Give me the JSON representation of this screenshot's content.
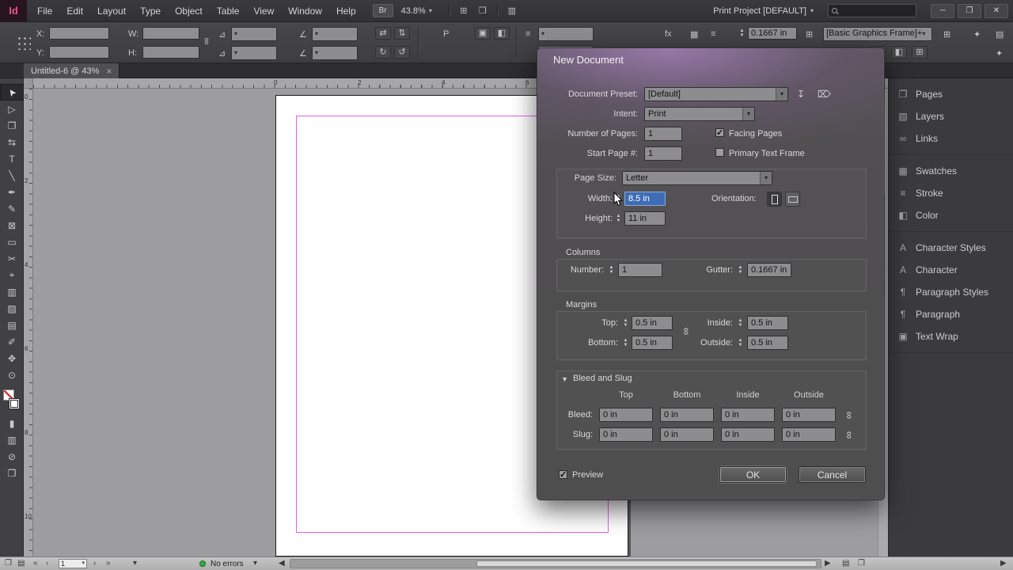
{
  "titlebar": {
    "logo": "Id",
    "menus": [
      "File",
      "Edit",
      "Layout",
      "Type",
      "Object",
      "Table",
      "View",
      "Window",
      "Help"
    ],
    "bridge_label": "Br",
    "zoom_value": "43.8%",
    "workspace_name": "Print Project [DEFAULT]"
  },
  "icons": {
    "chevron_down": "▾",
    "grid": "⊞",
    "screen_mode": "❒",
    "arrange_docs": "▥",
    "minimize": "─",
    "restore": "❐",
    "close": "✕",
    "chain": "∞",
    "flip_h": "⇄",
    "flip_v": "⇅",
    "rotate_cw": "↻",
    "rotate_ccw": "↺",
    "angle": "∠",
    "scale": "⊿",
    "stroke_lines": "≡",
    "swatch_grid": "▦",
    "container": "▣",
    "content": "◧",
    "effects_fx": "fx",
    "quick_apply": "✦",
    "list": "▤",
    "save_preset": "↧",
    "delete_preset": "⌦",
    "disclosure": "▼",
    "page_first": "«",
    "page_prev": "‹",
    "page_next": "›",
    "page_last": "»",
    "scroll_left": "◀",
    "scroll_right": "▶",
    "pages_proxy": "P"
  },
  "control_panel": {
    "x_label": "X:",
    "y_label": "Y:",
    "w_label": "W:",
    "h_label": "H:",
    "stroke_weight_value": "0.1667 in",
    "object_style_value": "[Basic Graphics Frame]+"
  },
  "tab": {
    "title": "Untitled-6 @ 43%",
    "close_glyph": "×"
  },
  "rulers": {
    "h_numbers": [
      "0",
      "2",
      "4",
      "6"
    ],
    "v_numbers": [
      "0",
      "2",
      "4",
      "6",
      "8",
      "10"
    ]
  },
  "toolbar": {
    "tools": [
      {
        "name": "selection",
        "glyph": "➤"
      },
      {
        "name": "direct-selection",
        "glyph": "▷"
      },
      {
        "name": "page",
        "glyph": "❐"
      },
      {
        "name": "gap",
        "glyph": "⇆"
      },
      {
        "name": "type",
        "glyph": "T"
      },
      {
        "name": "line",
        "glyph": "╲"
      },
      {
        "name": "pen",
        "glyph": "✒"
      },
      {
        "name": "pencil",
        "glyph": "✎"
      },
      {
        "name": "rectangle-frame",
        "glyph": "⊠"
      },
      {
        "name": "rectangle",
        "glyph": "▭"
      },
      {
        "name": "scissors",
        "glyph": "✂"
      },
      {
        "name": "free-transform",
        "glyph": "⌖"
      },
      {
        "name": "gradient",
        "glyph": "▥"
      },
      {
        "name": "gradient-feather",
        "glyph": "▨"
      },
      {
        "name": "note",
        "glyph": "▤"
      },
      {
        "name": "eyedropper",
        "glyph": "✐"
      },
      {
        "name": "hand",
        "glyph": "✥"
      },
      {
        "name": "zoom",
        "glyph": "⊙"
      }
    ],
    "bottom_tools": [
      {
        "name": "apply-color",
        "glyph": "▮"
      },
      {
        "name": "apply-gradient",
        "glyph": "▥"
      },
      {
        "name": "apply-none",
        "glyph": "⊘"
      },
      {
        "name": "screen-mode",
        "glyph": "❒"
      }
    ]
  },
  "right_panel": {
    "group1": [
      {
        "name": "pages",
        "glyph": "❐",
        "label": "Pages"
      },
      {
        "name": "layers",
        "glyph": "▧",
        "label": "Layers"
      },
      {
        "name": "links",
        "glyph": "∞",
        "label": "Links"
      }
    ],
    "group2": [
      {
        "name": "swatches",
        "glyph": "▦",
        "label": "Swatches"
      },
      {
        "name": "stroke",
        "glyph": "≡",
        "label": "Stroke"
      },
      {
        "name": "color",
        "glyph": "◧",
        "label": "Color"
      }
    ],
    "group3": [
      {
        "name": "character-styles",
        "glyph": "A",
        "label": "Character Styles"
      },
      {
        "name": "character",
        "glyph": "A",
        "label": "Character"
      },
      {
        "name": "paragraph-styles",
        "glyph": "¶",
        "label": "Paragraph Styles"
      },
      {
        "name": "paragraph",
        "glyph": "¶",
        "label": "Paragraph"
      },
      {
        "name": "text-wrap",
        "glyph": "▣",
        "label": "Text Wrap"
      }
    ]
  },
  "dialog": {
    "title": "New Document",
    "preset_label": "Document Preset:",
    "preset_value": "[Default]",
    "intent_label": "Intent:",
    "intent_value": "Print",
    "pages_label": "Number of Pages:",
    "pages_value": "1",
    "facing_pages_label": "Facing Pages",
    "start_page_label": "Start Page #:",
    "start_page_value": "1",
    "primary_text_frame_label": "Primary Text Frame",
    "page_size_label": "Page Size:",
    "page_size_value": "Letter",
    "width_label": "Width:",
    "width_value": "8.5 in",
    "height_label": "Height:",
    "height_value": "11 in",
    "orientation_label": "Orientation:",
    "columns_title": "Columns",
    "number_label": "Number:",
    "number_value": "1",
    "gutter_label": "Gutter:",
    "gutter_value": "0.1667 in",
    "margins_title": "Margins",
    "top_label": "Top:",
    "top_value": "0.5 in",
    "bottom_label": "Bottom:",
    "bottom_value": "0.5 in",
    "inside_label": "Inside:",
    "inside_value": "0.5 in",
    "outside_label": "Outside:",
    "outside_value": "0.5 in",
    "bleed_slug_title": "Bleed and Slug",
    "bs_headers": [
      "Top",
      "Bottom",
      "Inside",
      "Outside"
    ],
    "bleed_label": "Bleed:",
    "bleed_values": [
      "0 in",
      "0 in",
      "0 in",
      "0 in"
    ],
    "slug_label": "Slug:",
    "slug_values": [
      "0 in",
      "0 in",
      "0 in",
      "0 in"
    ],
    "preview_label": "Preview",
    "ok_label": "OK",
    "cancel_label": "Cancel"
  },
  "statusbar": {
    "page_value": "1",
    "error_text": "No errors"
  },
  "colors": {
    "selection_blue": "#3e6db5",
    "margin_guide": "#e75ee7",
    "error_green": "#35aa44",
    "logo_pink": "#ee4d9b"
  }
}
